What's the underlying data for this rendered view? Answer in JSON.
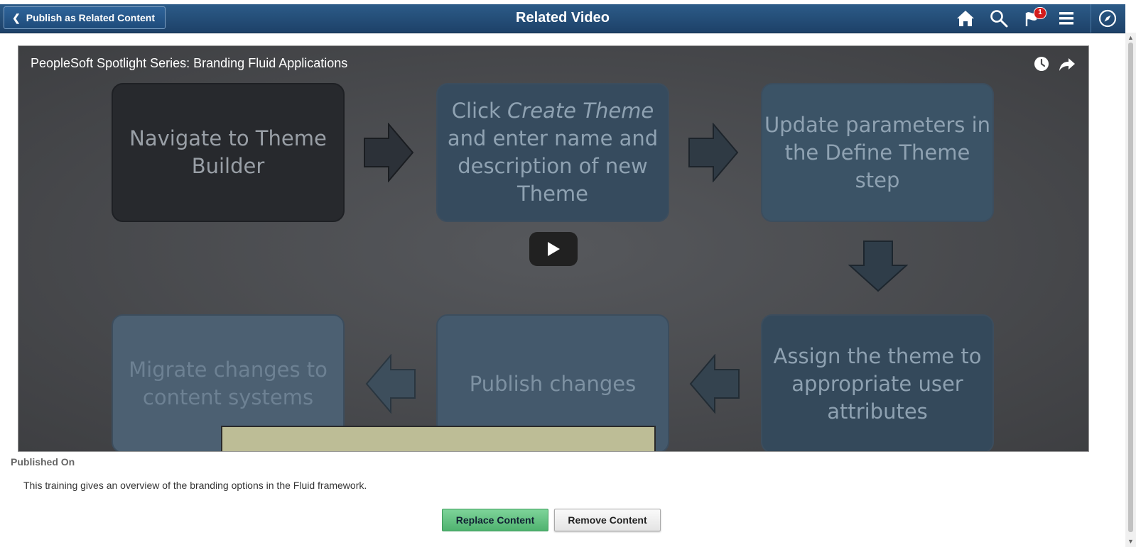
{
  "header": {
    "back_label": "Publish as Related Content",
    "title": "Related Video",
    "notification_count": "1",
    "icons": [
      "home-icon",
      "search-icon",
      "notifications-icon",
      "menu-icon",
      "navbar-icon"
    ]
  },
  "video": {
    "title": "PeopleSoft Spotlight Series: Branding Fluid Applications",
    "icons": [
      "watch-later-icon",
      "share-icon",
      "play-icon"
    ],
    "slide": {
      "step1": "Navigate to Theme Builder",
      "step2_prefix": "Click ",
      "step2_emph": "Create Theme",
      "step2_suffix": " and enter name and description of new Theme",
      "step3": "Update parameters in the Define Theme step",
      "step4": "Assign the theme to appropriate user attributes",
      "step5": "Publish changes",
      "step6": "Migrate changes to content systems"
    }
  },
  "published_on_label": "Published On",
  "description": "This training gives an overview of the branding options in the Fluid framework.",
  "buttons": {
    "replace": "Replace Content",
    "remove": "Remove Content"
  },
  "colors": {
    "header": "#1d4168",
    "replace_button": "#5cbf7c",
    "badge": "#d31c1c"
  }
}
